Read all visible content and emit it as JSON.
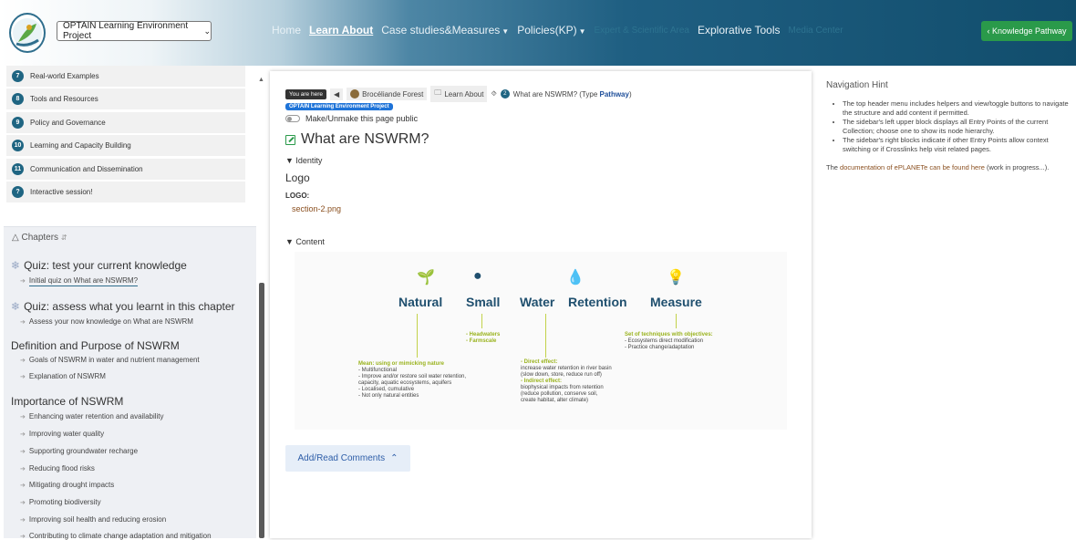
{
  "header": {
    "project_select": "OPTAIN Learning Environment Project",
    "nav": {
      "home": "Home",
      "learn_about": "Learn About",
      "case_studies": "Case studies&Measures",
      "policies": "Policies(KP)",
      "expert": "Expert & Scientific Area",
      "explorative": "Explorative Tools",
      "media": "Media Center"
    },
    "knowledge_pathway": "‹ Knowledge Pathway"
  },
  "sidebar": {
    "entries": [
      {
        "num": "7",
        "label": "Real-world Examples"
      },
      {
        "num": "8",
        "label": "Tools and Resources"
      },
      {
        "num": "9",
        "label": "Policy and Governance"
      },
      {
        "num": "10",
        "label": "Learning and Capacity Building"
      },
      {
        "num": "11",
        "label": "Communication and Dissemination"
      },
      {
        "num": "?",
        "label": "Interactive session!"
      }
    ],
    "chapters_label": "Chapters",
    "quiz1": "Quiz: test your current knowledge",
    "quiz1_item": "Initial quiz on What are NSWRM?",
    "quiz2": "Quiz: assess what you learnt in this chapter",
    "quiz2_item": "Assess your now knowledge on What are NSWRM",
    "section1": "Definition and Purpose of NSWRM",
    "section1_items": [
      "Goals of NSWRM in water and nutrient management",
      "Explanation of NSWRM"
    ],
    "section2": "Importance of NSWRM",
    "section2_items": [
      "Enhancing water retention and availability",
      "Improving water quality",
      "Supporting groundwater recharge",
      "Reducing flood risks",
      "Mitigating drought impacts",
      "Promoting biodiversity",
      "Improving soil health and reducing erosion",
      "Contributing to climate change adaptation and mitigation"
    ]
  },
  "main": {
    "you_are_here": "You are here",
    "crumb_forest": "Brocéliande Forest",
    "crumb_learn": "Learn About",
    "crumb_num": "2",
    "crumb_current": "What are NSWRM? (Type",
    "crumb_type": "Pathway",
    "crumb_close": ")",
    "project_badge": "OPTAIN Learning Environment Project",
    "toggle_label": "Make/Unmake this page public",
    "title": "What are NSWRM?",
    "identity": "▼ Identity",
    "logo_heading": "Logo",
    "logo_label": "LOGO:",
    "logo_file": "section-2.png",
    "content": "▼ Content",
    "comments": "Add/Read Comments"
  },
  "infographic": {
    "words": [
      "Natural",
      "Small",
      "Water",
      "Retention",
      "Measure"
    ],
    "natural_head": "Mean: using or mimicking nature",
    "natural_lines": [
      "- Multifunctional",
      "- Improve and/or restore soil water retention,",
      "  capacity, aquatic ecosystems, aquifers",
      "- Localised, cumulative",
      "- Not only natural entities"
    ],
    "small_lines": [
      "- Headwaters",
      "- Farmscale"
    ],
    "water_head": "- Direct effect:",
    "water_lines": [
      "  increase water retention in river basin",
      "  (slow down, store, reduce run off)"
    ],
    "water_head2": "- Indirect effect:",
    "water_lines2": [
      "  biophysical impacts from retention",
      "  (reduce pollution, conserve soil,",
      "  create habitat, alter climate)"
    ],
    "measure_head": "Set of techniques with objectives:",
    "measure_lines": [
      "- Ecosystems direct modification",
      "- Practice change/adaptation"
    ]
  },
  "hint": {
    "title": "Navigation Hint",
    "bullets": [
      "The top header menu includes helpers and view/toggle buttons to navigate the structure and add content if permitted.",
      "The sidebar's left upper block displays all Entry Points of the current Collection; choose one to show its node hierarchy.",
      "The sidebar's right blocks indicate if other Entry Points allow context switching or if Crosslinks help visit related pages."
    ],
    "doc_prefix": "The",
    "doc_link": "documentation of ePLANETe can be found here",
    "doc_suffix": "(work in progress...)."
  },
  "colors": {
    "header_dark": "#114d6c",
    "accent_green": "#2a9a4a",
    "entry_num_bg": "#1f6582",
    "chapters_bg": "#eef0f4"
  }
}
